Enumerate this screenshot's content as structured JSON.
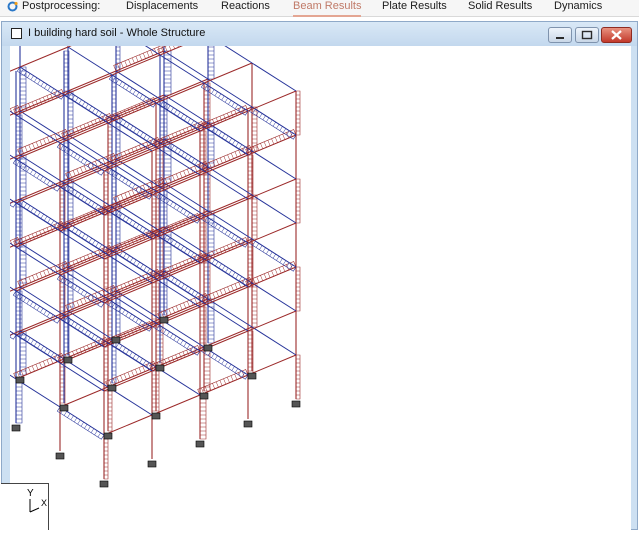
{
  "tabs": [
    {
      "label": "Postprocessing:"
    },
    {
      "label": "Displacements"
    },
    {
      "label": "Reactions"
    },
    {
      "label": "Beam Results"
    },
    {
      "label": "Plate Results"
    },
    {
      "label": "Solid Results"
    },
    {
      "label": "Dynamics"
    }
  ],
  "window": {
    "title": "I building hard soil - Whole Structure"
  },
  "axes": {
    "y": "Y",
    "x": "X"
  },
  "colors": {
    "beam_red": "#9c2a2a",
    "beam_blue": "#27349a",
    "active_tab": "#c07a68"
  }
}
